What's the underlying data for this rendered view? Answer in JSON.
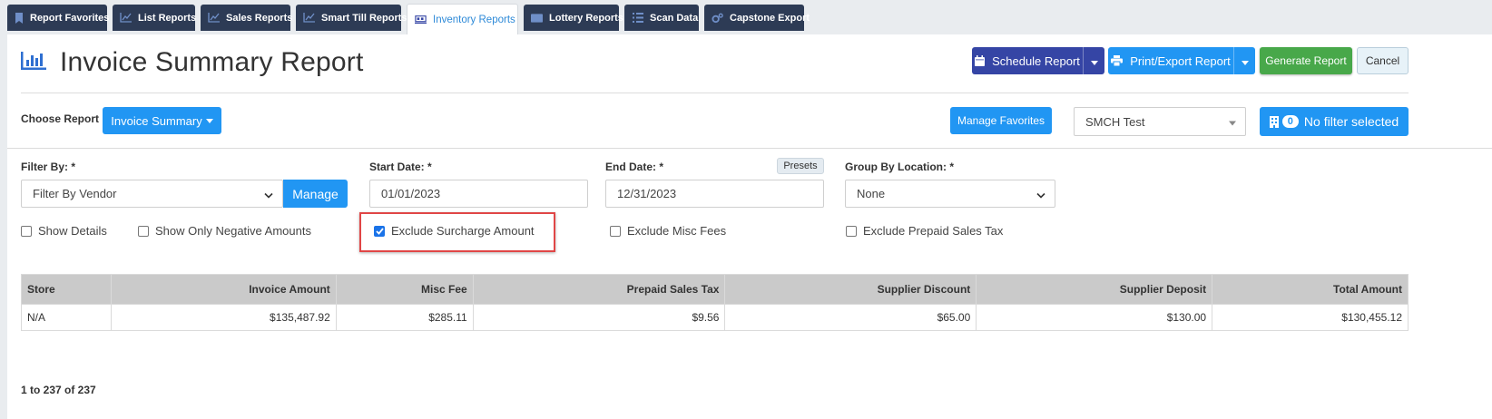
{
  "tabs": [
    {
      "label": "Report Favorites",
      "icon": "bookmark-icon",
      "active": false
    },
    {
      "label": "List Reports",
      "icon": "chart-line-icon",
      "active": false
    },
    {
      "label": "Sales Reports",
      "icon": "chart-line-icon",
      "active": false
    },
    {
      "label": "Smart Till Reports",
      "icon": "chart-line-icon",
      "active": false
    },
    {
      "label": "Inventory Reports",
      "icon": "pallet-icon",
      "active": true
    },
    {
      "label": "Lottery Reports",
      "icon": "ticket-icon",
      "active": false
    },
    {
      "label": "Scan Data",
      "icon": "list-icon",
      "active": false
    },
    {
      "label": "Capstone Export",
      "icon": "cogs-icon",
      "active": false
    }
  ],
  "header": {
    "title": "Invoice Summary Report",
    "schedule_label": "Schedule Report",
    "print_label": "Print/Export Report",
    "generate_label": "Generate Report",
    "cancel_label": "Cancel"
  },
  "choose": {
    "label": "Choose Report",
    "report_selected": "Invoice Summary",
    "manage_favorites_label": "Manage Favorites",
    "store_selected": "SMCH Test",
    "filter_count": "0",
    "filter_text": "No filter selected"
  },
  "filters": {
    "filter_by_label": "Filter By: *",
    "filter_by_value": "Filter By Vendor",
    "manage_label": "Manage",
    "start_label": "Start Date: *",
    "start_value": "01/01/2023",
    "end_label": "End Date: *",
    "end_value": "12/31/2023",
    "presets_label": "Presets",
    "group_label": "Group By Location: *",
    "group_value": "None"
  },
  "options": [
    {
      "label": "Show Details",
      "checked": false
    },
    {
      "label": "Show Only Negative Amounts",
      "checked": false
    },
    {
      "label": "Exclude Surcharge Amount",
      "checked": true
    },
    {
      "label": "Exclude Misc Fees",
      "checked": false
    },
    {
      "label": "Exclude Prepaid Sales Tax",
      "checked": false
    }
  ],
  "table": {
    "headers": [
      "Store",
      "Invoice Amount",
      "Misc Fee",
      "Prepaid Sales Tax",
      "Supplier Discount",
      "Supplier Deposit",
      "Total Amount"
    ],
    "rows": [
      [
        "N/A",
        "$135,487.92",
        "$285.11",
        "$9.56",
        "$65.00",
        "$130.00",
        "$130,455.12"
      ]
    ]
  },
  "pager": "1 to 237 of 237",
  "colors": {
    "navy": "#3545a5",
    "blue": "#2196f3",
    "green": "#48a84a",
    "tab_dark": "#2d3b55",
    "highlight": "#e04646"
  }
}
